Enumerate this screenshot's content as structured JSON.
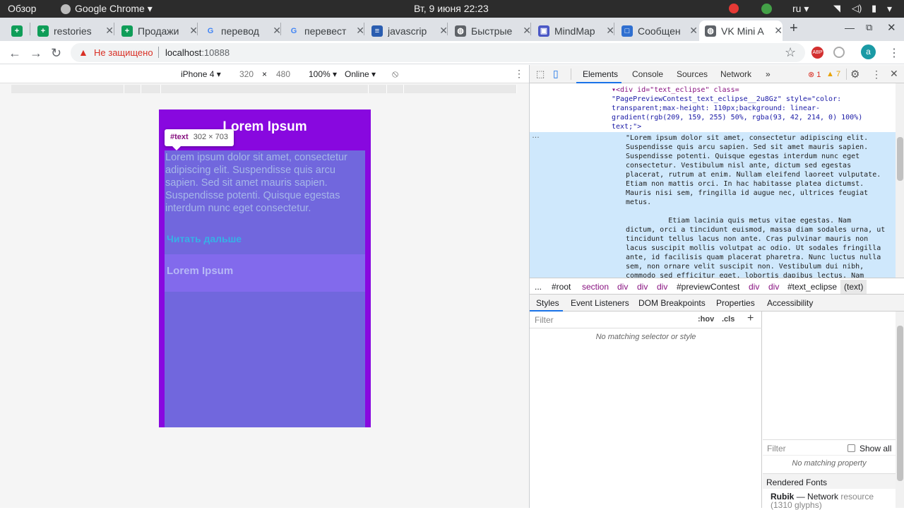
{
  "os_bar": {
    "overview": "Обзор",
    "app": "Google Chrome ▾",
    "datetime": "Вт, 9 июня  22:23",
    "lang": "ru ▾"
  },
  "tabs": [
    {
      "label": "",
      "color": "#0f9d58",
      "glyph": "+"
    },
    {
      "label": "restories",
      "color": "#0f9d58",
      "glyph": "+"
    },
    {
      "label": "Продажи",
      "color": "#0f9d58",
      "glyph": "+"
    },
    {
      "label": "перевод",
      "color": "#ffffff",
      "glyph": "G"
    },
    {
      "label": "перевест",
      "color": "#ffffff",
      "glyph": "G"
    },
    {
      "label": "javascrip",
      "color": "#2a5db0",
      "glyph": "≡"
    },
    {
      "label": "Быстрые",
      "color": "#5f6368",
      "glyph": "◍"
    },
    {
      "label": "MindMap",
      "color": "#4a57c5",
      "glyph": "▣"
    },
    {
      "label": "Сообщен",
      "color": "#2f6fd0",
      "glyph": "□"
    },
    {
      "label": "VK Mini A",
      "color": "#5f6368",
      "glyph": "◍"
    }
  ],
  "omnibox": {
    "security": "Не защищено",
    "host": "localhost",
    "port": ":10888",
    "avatar": "a"
  },
  "device_bar": {
    "device": "iPhone 4 ▾",
    "width": "320",
    "x": "×",
    "height": "480",
    "zoom": "100% ▾",
    "network": "Online ▾"
  },
  "phone": {
    "title": "Lorem Ipsum",
    "paragraph": "Lorem ipsum dolor sit amet, consectetur adipiscing elit. Suspendisse quis arcu sapien. Sed sit amet mauris sapien. Suspendisse potenti. Quisque egestas interdum nunc eget consectetur.",
    "read_more": "Читать дальше",
    "second_title": "Lorem Ipsum"
  },
  "tooltip": {
    "node": "#text",
    "size": "302 × 703"
  },
  "devtools": {
    "tabs": [
      "Elements",
      "Console",
      "Sources",
      "Network",
      "»"
    ],
    "errors": "1",
    "warnings": "7",
    "code_line1": "▾<div id=\"text_eclipse\" class=",
    "code_line2": "\"PagePreviewContest_text_eclipse__2u8Gz\" style=\"color:",
    "code_line3": "transparent;max-height: 110px;background: linear-",
    "code_line4": "gradient(rgb(209, 159, 255) 50%, rgba(93, 42, 214, 0) 100%)",
    "code_line5": "text;\">",
    "selected_text": "\"Lorem ipsum dolor sit amet, consectetur adipiscing elit.\nSuspendisse quis arcu sapien. Sed sit amet mauris sapien.\nSuspendisse potenti. Quisque egestas interdum nunc eget\nconsectetur. Vestibulum nisl ante, dictum sed egestas\nplacerat, rutrum at enim. Nullam eleifend laoreet vulputate.\nEtiam non mattis orci. In hac habitasse platea dictumst.\nMauris nisi sem, fringilla id augue nec, ultrices feugiat\nmetus.\n\n          Etiam lacinia quis metus vitae egestas. Nam\ndictum, orci a tincidunt euismod, massa diam sodales urna, ut\ntincidunt tellus lacus non ante. Cras pulvinar mauris non\nlacus suscipit mollis volutpat ac odio. Ut sodales fringilla\nante, id facilisis quam placerat pharetra. Nunc luctus nulla\nsem, non ornare velit suscipit non. Vestibulum dui nibh,\ncommodo sed efficitur eget, lobortis dapibus lectus. Nam",
    "breadcrumbs": [
      "...",
      "#root",
      "section",
      "div",
      "div",
      "div",
      "#previewContest",
      "div",
      "div",
      "#text_eclipse",
      "(text)"
    ],
    "lower_tabs": [
      "Styles",
      "Event Listeners",
      "DOM Breakpoints",
      "Properties",
      "Accessibility"
    ],
    "filter": "Filter",
    "hov": ":hov",
    "cls": ".cls",
    "plus": "+",
    "no_match": "No matching selector or style",
    "filter2": "Filter",
    "show_all": "Show all",
    "no_property": "No matching property",
    "rendered_fonts": "Rendered Fonts",
    "font_name": "Rubik",
    "font_dash": "—",
    "font_source": "Network",
    "font_resource": "resource (1310 glyphs)"
  }
}
